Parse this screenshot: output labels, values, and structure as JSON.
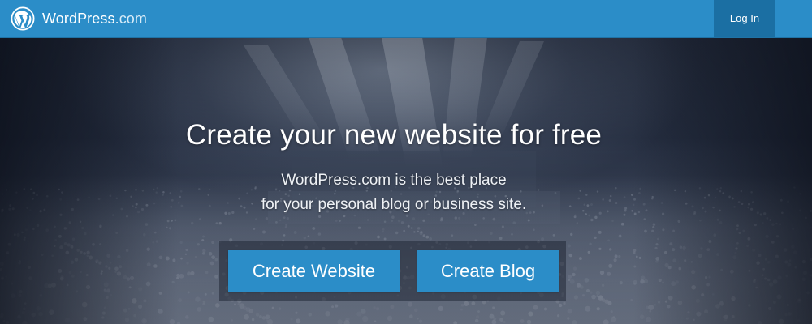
{
  "header": {
    "brand_strong": "WordPress",
    "brand_light": ".com",
    "login_label": "Log In"
  },
  "hero": {
    "headline": "Create your new website for free",
    "subline_1": "WordPress.com is the best place",
    "subline_2": "for your personal blog or business site."
  },
  "actions": {
    "create_website_label": "Create Website",
    "create_blog_label": "Create Blog"
  },
  "colors": {
    "brand_blue": "#2b8dc8",
    "login_bg": "#1b6fa3"
  }
}
